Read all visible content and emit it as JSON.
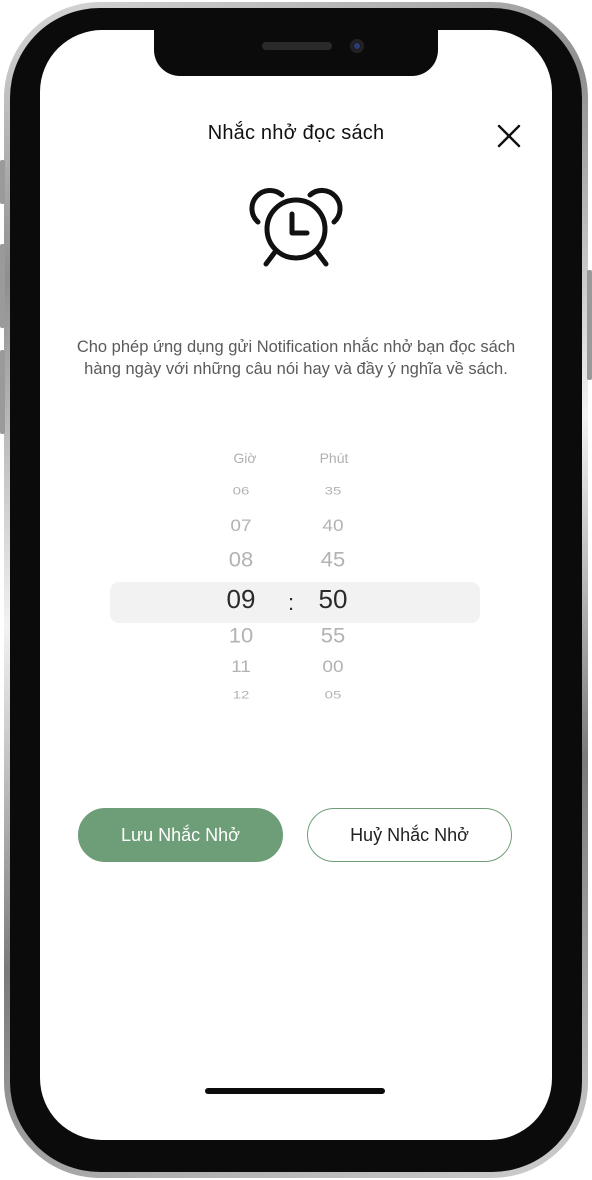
{
  "header": {
    "title": "Nhắc nhở đọc sách",
    "close_icon": "close-icon",
    "alarm_icon": "alarm-clock-icon"
  },
  "description": "Cho phép ứng dụng gửi Notification nhắc nhở bạn đọc sách hàng ngày với những câu nói hay và đầy ý nghĩa về sách.",
  "picker": {
    "hour_label": "Giờ",
    "minute_label": "Phút",
    "hours": [
      "06",
      "07",
      "08",
      "09",
      "10",
      "11",
      "12"
    ],
    "minutes": [
      "35",
      "40",
      "45",
      "50",
      "55",
      "00",
      "05"
    ],
    "selected_hour": "09",
    "selected_minute": "50",
    "separator": ":"
  },
  "buttons": {
    "save_label": "Lưu Nhắc Nhở",
    "cancel_label": "Huỷ Nhắc Nhở"
  },
  "colors": {
    "accent": "#6e9e78",
    "highlight": "#f2f2f2",
    "text_muted": "#b3b3b3"
  }
}
